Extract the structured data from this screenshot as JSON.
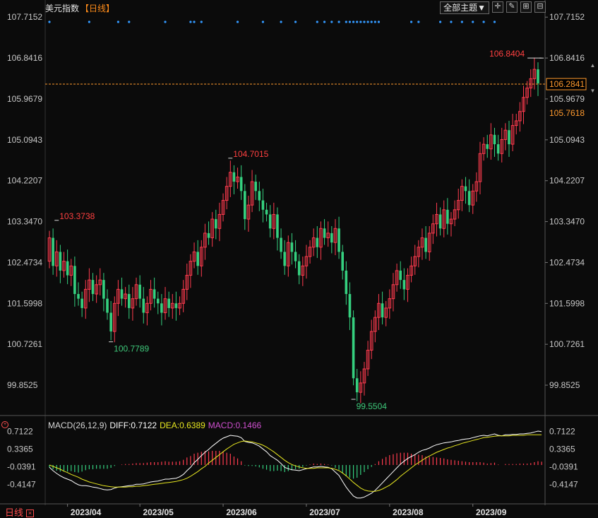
{
  "header": {
    "instrument": "美元指数",
    "period": "【日线】",
    "theme_button": "全部主题▼"
  },
  "toolbar": [
    {
      "name": "crosshair-tool-icon",
      "glyph": "✛"
    },
    {
      "name": "draw-tool-icon",
      "glyph": "✎"
    },
    {
      "name": "zoom-in-icon",
      "glyph": "⊞"
    },
    {
      "name": "zoom-out-icon",
      "glyph": "⊟"
    }
  ],
  "price_axis": {
    "ticks": [
      "107.7152",
      "106.8416",
      "105.9679",
      "105.0943",
      "104.2207",
      "103.3470",
      "102.4734",
      "101.5998",
      "100.7261",
      "99.8525"
    ]
  },
  "price_labels": {
    "current": "106.2841",
    "secondary": "105.7618",
    "max_mark": "106.8404",
    "hi_apr": "103.3738",
    "lo_apr": "100.7789",
    "hi_may": "104.7015",
    "lo_jul": "99.5504"
  },
  "macd": {
    "params": "MACD(26,12,9)",
    "diff_text": "DIFF:0.7122",
    "dea_text": "DEA:0.6389",
    "macd_text": "MACD:0.1466",
    "ticks": [
      "0.7122",
      "0.3365",
      "-0.0391",
      "-0.4147"
    ]
  },
  "time_axis": [
    "2023/04",
    "2023/05",
    "2023/06",
    "2023/07",
    "2023/08",
    "2023/09"
  ],
  "footer": {
    "period_tab": "日线",
    "close": "×"
  },
  "colors": {
    "up": "#ff3b4e",
    "down": "#35d07f",
    "grid": "#2f2f2f",
    "text": "#c8c8c8",
    "current": "#ff9a2e",
    "diff_line": "#ffffff",
    "dea_line": "#e8e820",
    "macd_label": "#d050d0",
    "dots": "#3399ff",
    "hi_label": "#ff4040",
    "lo_label": "#3ec87a"
  },
  "chart_data": {
    "type": "candlestick",
    "title": "美元指数 日线",
    "ylim": [
      99.4,
      107.9
    ],
    "y_ticks": [
      107.7152,
      106.8416,
      105.9679,
      105.0943,
      104.2207,
      103.347,
      102.4734,
      101.5998,
      100.7261,
      99.8525
    ],
    "x_labels": [
      "2023/04",
      "2023/05",
      "2023/06",
      "2023/07",
      "2023/08",
      "2023/09"
    ],
    "x_label_bar_index": [
      5,
      25,
      48,
      71,
      94,
      117
    ],
    "annotations": [
      {
        "text": "103.3738",
        "bar": 2,
        "value": 103.3738,
        "kind": "high"
      },
      {
        "text": "100.7789",
        "bar": 17,
        "value": 100.7789,
        "kind": "low"
      },
      {
        "text": "104.7015",
        "bar": 50,
        "value": 104.7015,
        "kind": "high"
      },
      {
        "text": "99.5504",
        "bar": 84,
        "value": 99.5504,
        "kind": "low"
      },
      {
        "text": "106.8404",
        "bar": 136,
        "value": 106.8404,
        "kind": "high"
      }
    ],
    "current_price": 106.2841,
    "close_values": [
      103.0,
      102.4,
      102.7,
      102.3,
      102.5,
      102.2,
      102.4,
      101.8,
      101.7,
      101.5,
      101.9,
      102.1,
      101.8,
      102.0,
      102.1,
      101.7,
      101.4,
      101.0,
      101.6,
      101.9,
      101.7,
      101.8,
      101.5,
      101.7,
      102.0,
      101.7,
      101.4,
      101.6,
      101.9,
      101.7,
      101.6,
      101.4,
      101.7,
      101.5,
      101.6,
      101.5,
      101.6,
      101.9,
      102.2,
      102.5,
      102.7,
      102.4,
      102.8,
      103.1,
      103.0,
      103.4,
      103.2,
      103.5,
      103.8,
      104.1,
      104.4,
      104.2,
      104.3,
      104.0,
      103.4,
      103.7,
      104.2,
      104.0,
      103.8,
      103.6,
      103.5,
      103.2,
      103.5,
      103.0,
      102.7,
      102.4,
      102.9,
      102.7,
      102.5,
      102.2,
      102.4,
      102.6,
      102.8,
      103.0,
      102.8,
      103.2,
      103.0,
      103.1,
      102.9,
      103.2,
      102.7,
      102.3,
      101.8,
      101.3,
      100.0,
      99.7,
      99.9,
      100.2,
      100.6,
      101.0,
      101.3,
      101.6,
      101.3,
      101.5,
      101.7,
      102.0,
      102.3,
      102.1,
      101.9,
      102.2,
      102.4,
      102.6,
      102.8,
      103.0,
      102.7,
      103.1,
      103.3,
      103.5,
      103.2,
      103.6,
      103.3,
      103.4,
      103.6,
      103.8,
      104.1,
      104.0,
      103.7,
      104.0,
      104.2,
      104.8,
      105.0,
      104.9,
      105.2,
      105.0,
      104.8,
      105.1,
      105.3,
      105.0,
      105.4,
      105.5,
      105.7,
      106.0,
      106.2,
      106.4,
      106.6,
      106.3
    ],
    "open_values": [
      102.5,
      103.0,
      102.4,
      102.7,
      102.3,
      102.5,
      102.2,
      102.4,
      101.8,
      101.7,
      101.5,
      101.9,
      102.1,
      101.8,
      102.0,
      102.1,
      101.7,
      101.4,
      101.0,
      101.6,
      101.9,
      101.7,
      101.8,
      101.5,
      101.7,
      102.0,
      101.7,
      101.4,
      101.6,
      101.9,
      101.7,
      101.6,
      101.4,
      101.7,
      101.5,
      101.6,
      101.5,
      101.6,
      101.9,
      102.2,
      102.5,
      102.7,
      102.4,
      102.8,
      103.1,
      103.0,
      103.4,
      103.2,
      103.5,
      103.8,
      104.1,
      104.4,
      104.2,
      104.3,
      104.0,
      103.4,
      103.7,
      104.2,
      104.0,
      103.8,
      103.6,
      103.5,
      103.2,
      103.5,
      103.0,
      102.7,
      102.4,
      102.9,
      102.7,
      102.5,
      102.2,
      102.4,
      102.6,
      102.8,
      103.0,
      102.8,
      103.2,
      103.0,
      103.1,
      102.9,
      103.2,
      102.7,
      102.3,
      101.8,
      101.3,
      100.0,
      99.7,
      99.9,
      100.2,
      100.6,
      101.0,
      101.3,
      101.6,
      101.3,
      101.5,
      101.7,
      102.0,
      102.3,
      102.1,
      101.9,
      102.2,
      102.4,
      102.6,
      102.8,
      103.0,
      102.7,
      103.1,
      103.3,
      103.5,
      103.2,
      103.6,
      103.3,
      103.4,
      103.6,
      103.8,
      104.1,
      104.0,
      103.7,
      104.0,
      104.2,
      104.8,
      105.0,
      104.9,
      105.2,
      105.0,
      104.8,
      105.1,
      105.3,
      105.0,
      105.4,
      105.5,
      105.7,
      106.0,
      106.2,
      106.4,
      106.6
    ],
    "macd_ylim": [
      -0.75,
      0.9
    ],
    "macd_ticks": [
      0.7122,
      0.3365,
      -0.0391,
      -0.4147
    ],
    "macd_diff": [
      -0.05,
      -0.12,
      -0.18,
      -0.23,
      -0.27,
      -0.3,
      -0.33,
      -0.38,
      -0.42,
      -0.44,
      -0.44,
      -0.45,
      -0.47,
      -0.48,
      -0.5,
      -0.52,
      -0.53,
      -0.52,
      -0.49,
      -0.47,
      -0.46,
      -0.45,
      -0.44,
      -0.43,
      -0.41,
      -0.41,
      -0.4,
      -0.38,
      -0.36,
      -0.35,
      -0.34,
      -0.32,
      -0.3,
      -0.3,
      -0.29,
      -0.28,
      -0.25,
      -0.2,
      -0.12,
      -0.05,
      0.05,
      0.12,
      0.2,
      0.27,
      0.33,
      0.4,
      0.46,
      0.52,
      0.57,
      0.6,
      0.63,
      0.62,
      0.61,
      0.58,
      0.5,
      0.48,
      0.47,
      0.44,
      0.4,
      0.34,
      0.28,
      0.2,
      0.15,
      0.1,
      0.03,
      -0.05,
      -0.08,
      -0.1,
      -0.11,
      -0.12,
      -0.1,
      -0.08,
      -0.06,
      -0.04,
      -0.04,
      -0.03,
      -0.04,
      -0.05,
      -0.08,
      -0.15,
      -0.22,
      -0.35,
      -0.47,
      -0.57,
      -0.66,
      -0.7,
      -0.7,
      -0.68,
      -0.64,
      -0.6,
      -0.54,
      -0.46,
      -0.38,
      -0.3,
      -0.22,
      -0.14,
      -0.06,
      0.02,
      0.08,
      0.14,
      0.18,
      0.22,
      0.27,
      0.31,
      0.33,
      0.36,
      0.4,
      0.43,
      0.45,
      0.47,
      0.48,
      0.49,
      0.51,
      0.52,
      0.54,
      0.55,
      0.56,
      0.58,
      0.6,
      0.62,
      0.63,
      0.62,
      0.64,
      0.66,
      0.63,
      0.62,
      0.64,
      0.64,
      0.65,
      0.65,
      0.66,
      0.66,
      0.67,
      0.68,
      0.7,
      0.72,
      0.71
    ],
    "macd_dea": [
      0.0,
      -0.03,
      -0.06,
      -0.09,
      -0.13,
      -0.16,
      -0.2,
      -0.23,
      -0.26,
      -0.3,
      -0.33,
      -0.36,
      -0.38,
      -0.4,
      -0.42,
      -0.44,
      -0.45,
      -0.46,
      -0.47,
      -0.47,
      -0.47,
      -0.47,
      -0.46,
      -0.46,
      -0.45,
      -0.45,
      -0.44,
      -0.43,
      -0.42,
      -0.41,
      -0.4,
      -0.39,
      -0.38,
      -0.37,
      -0.36,
      -0.35,
      -0.33,
      -0.31,
      -0.28,
      -0.24,
      -0.19,
      -0.14,
      -0.08,
      -0.03,
      0.04,
      0.1,
      0.16,
      0.22,
      0.28,
      0.34,
      0.39,
      0.44,
      0.47,
      0.5,
      0.51,
      0.5,
      0.49,
      0.47,
      0.45,
      0.42,
      0.38,
      0.33,
      0.28,
      0.22,
      0.16,
      0.1,
      0.05,
      0.01,
      -0.02,
      -0.04,
      -0.06,
      -0.07,
      -0.07,
      -0.07,
      -0.06,
      -0.06,
      -0.06,
      -0.06,
      -0.07,
      -0.09,
      -0.12,
      -0.17,
      -0.23,
      -0.3,
      -0.37,
      -0.43,
      -0.49,
      -0.53,
      -0.55,
      -0.56,
      -0.56,
      -0.54,
      -0.51,
      -0.47,
      -0.43,
      -0.37,
      -0.31,
      -0.24,
      -0.18,
      -0.12,
      -0.06,
      0.0,
      0.05,
      0.1,
      0.15,
      0.19,
      0.23,
      0.27,
      0.3,
      0.33,
      0.36,
      0.38,
      0.41,
      0.43,
      0.46,
      0.48,
      0.5,
      0.52,
      0.54,
      0.56,
      0.58,
      0.59,
      0.6,
      0.61,
      0.62,
      0.62,
      0.62,
      0.62,
      0.63,
      0.63,
      0.63,
      0.63,
      0.64,
      0.64,
      0.64,
      0.64,
      0.64
    ],
    "macd_hist": [
      -0.05,
      -0.09,
      -0.12,
      -0.14,
      -0.14,
      -0.14,
      -0.13,
      -0.15,
      -0.16,
      -0.14,
      -0.11,
      -0.09,
      -0.09,
      -0.08,
      -0.08,
      -0.08,
      -0.08,
      -0.06,
      -0.02,
      0.0,
      0.01,
      0.02,
      0.02,
      0.03,
      0.04,
      0.04,
      0.04,
      0.05,
      0.06,
      0.06,
      0.06,
      0.07,
      0.08,
      0.07,
      0.07,
      0.07,
      0.08,
      0.11,
      0.16,
      0.19,
      0.24,
      0.26,
      0.28,
      0.3,
      0.29,
      0.3,
      0.3,
      0.3,
      0.29,
      0.26,
      0.24,
      0.18,
      0.14,
      0.08,
      -0.01,
      -0.02,
      -0.02,
      -0.03,
      -0.05,
      -0.08,
      -0.1,
      -0.13,
      -0.13,
      -0.12,
      -0.13,
      -0.15,
      -0.13,
      -0.11,
      -0.09,
      -0.08,
      -0.04,
      -0.01,
      0.01,
      0.03,
      0.02,
      0.03,
      0.02,
      0.01,
      -0.01,
      -0.06,
      -0.1,
      -0.18,
      -0.24,
      -0.27,
      -0.29,
      -0.27,
      -0.21,
      -0.15,
      -0.09,
      -0.04,
      0.02,
      0.08,
      0.13,
      0.17,
      0.21,
      0.23,
      0.25,
      0.26,
      0.26,
      0.26,
      0.24,
      0.22,
      0.22,
      0.21,
      0.18,
      0.17,
      0.17,
      0.16,
      0.15,
      0.14,
      0.12,
      0.11,
      0.1,
      0.09,
      0.08,
      0.07,
      0.06,
      0.06,
      0.06,
      0.06,
      0.05,
      0.03,
      0.04,
      0.05,
      0.01,
      0.0,
      0.02,
      0.02,
      0.02,
      0.02,
      0.03,
      0.03,
      0.03,
      0.04,
      0.06,
      0.08,
      0.07
    ]
  }
}
